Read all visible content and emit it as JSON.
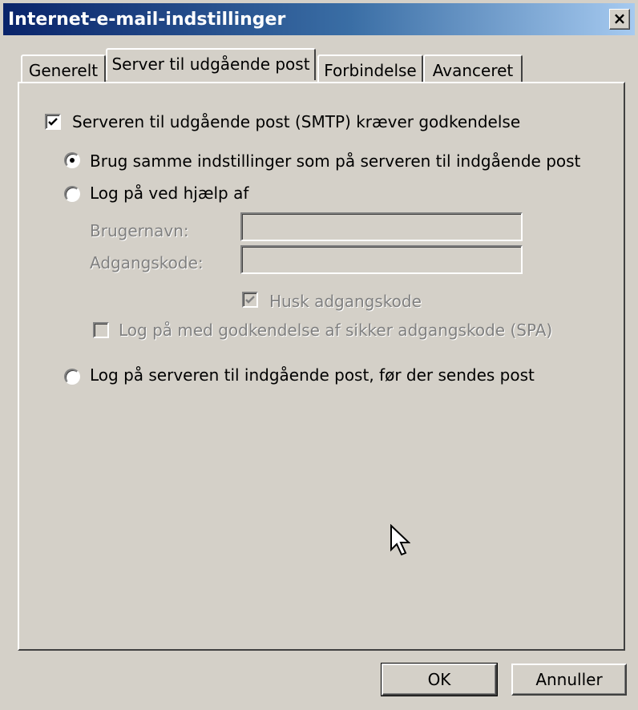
{
  "window": {
    "title": "Internet-e-mail-indstillinger",
    "close_glyph": "×"
  },
  "tabs": [
    {
      "label": "Generelt",
      "active": false
    },
    {
      "label": "Server til udgående post",
      "active": true
    },
    {
      "label": "Forbindelse",
      "active": false
    },
    {
      "label": "Avanceret",
      "active": false
    }
  ],
  "smtp": {
    "requires_auth_label": "Serveren til udgående post (SMTP) kræver godkendelse",
    "requires_auth_checked": true,
    "options": [
      {
        "label": "Brug samme indstillinger som på serveren til indgående post",
        "selected": true
      },
      {
        "label": "Log på ved hjælp af",
        "selected": false
      },
      {
        "label": "Log på serveren til indgående post, før der sendes post",
        "selected": false
      }
    ],
    "username_label": "Brugernavn:",
    "username_value": "",
    "password_label": "Adgangskode:",
    "password_value": "",
    "remember_password_label": "Husk adgangskode",
    "remember_password_checked": true,
    "spa_label": "Log på med godkendelse af sikker adgangskode (SPA)",
    "spa_checked": false
  },
  "buttons": {
    "ok": "OK",
    "cancel": "Annuller"
  },
  "colors": {
    "face": "#d4d0c8",
    "title_start": "#0a246a",
    "title_end": "#a6caf0",
    "disabled_text": "#808080"
  }
}
